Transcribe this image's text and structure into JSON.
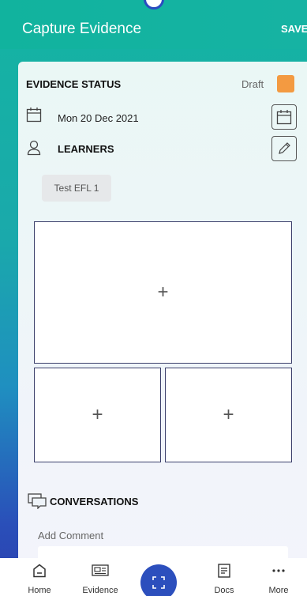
{
  "header": {
    "title": "Capture Evidence",
    "save_label": "SAVE"
  },
  "status": {
    "label": "EVIDENCE STATUS",
    "value": "Draft",
    "color": "#f39a41"
  },
  "date": {
    "value": "Mon 20 Dec 2021",
    "icon": "calendar-icon"
  },
  "learners": {
    "label": "LEARNERS",
    "icon": "person-icon",
    "items": [
      "Test  EFL 1"
    ]
  },
  "photos": {
    "add_symbol": "+"
  },
  "conversations": {
    "label": "CONVERSATIONS",
    "comment_label": "Add Comment"
  },
  "nav": {
    "items": [
      {
        "label": "Home",
        "icon": "home-icon"
      },
      {
        "label": "Evidence",
        "icon": "evidence-icon"
      },
      {
        "label": "Docs",
        "icon": "docs-icon"
      },
      {
        "label": "More",
        "icon": "more-icon"
      }
    ],
    "center_icon": "scan-icon"
  },
  "colors": {
    "header": "#11b39e",
    "accent": "#2c4fbd"
  }
}
